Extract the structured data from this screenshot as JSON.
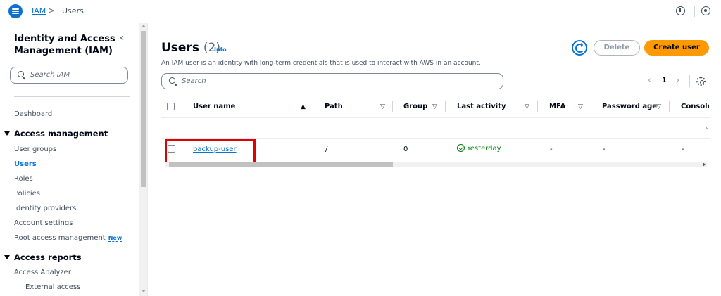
{
  "breadcrumb": {
    "root": "IAM",
    "separator": ">",
    "current": "Users"
  },
  "topbar_icons": [
    "menu-icon",
    "info-icon",
    "settings-icon"
  ],
  "sidebar": {
    "title": "Identity and Access Management (IAM)",
    "collapse": "‹",
    "search_placeholder": "Search IAM",
    "dashboard": "Dashboard",
    "section_access_management": "Access management",
    "items": [
      "User groups",
      "Users",
      "Roles",
      "Policies",
      "Identity providers",
      "Account settings",
      "Root access management"
    ],
    "active_item": "Users",
    "new_badge": "New",
    "section_access_reports": "Access reports",
    "reports_items": [
      "Access Analyzer",
      "External access"
    ]
  },
  "main": {
    "title": "Users",
    "count": "(2)",
    "info": "Info",
    "description": "An IAM user is an identity with long-term credentials that is used to interact with AWS in an account.",
    "delete_label": "Delete",
    "create_label": "Create user",
    "search_placeholder": "Search",
    "pager": {
      "prev": "‹",
      "page": "1",
      "next": "›"
    }
  },
  "table": {
    "columns": [
      "User name",
      "Path",
      "Groups",
      "Last activity",
      "MFA",
      "Password age",
      "Console"
    ],
    "sort_asc": "▲",
    "sort_desc": "▽",
    "rows": [
      {
        "user_name": "backup-user",
        "path": "/",
        "groups": "0",
        "last_activity": "Yesterday",
        "mfa": "-",
        "password_age": "-",
        "console": "-"
      }
    ]
  },
  "colors": {
    "link": "#0972d3",
    "primary": "#ff9900",
    "success": "#037f0c",
    "highlight": "#e00000"
  }
}
